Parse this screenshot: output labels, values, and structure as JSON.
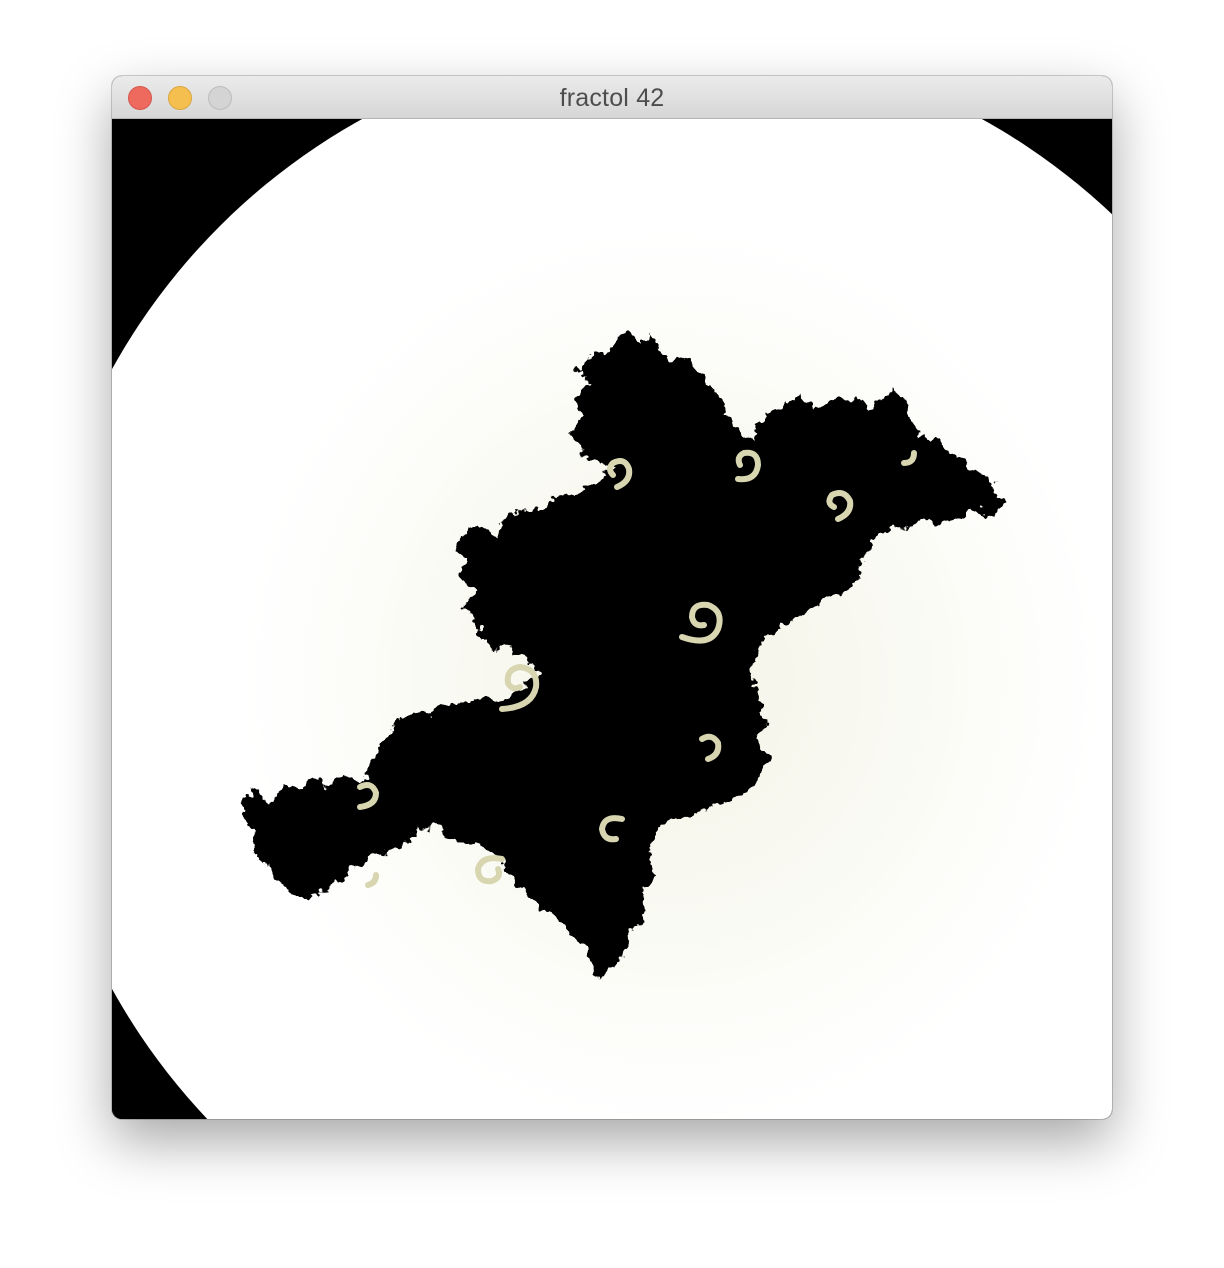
{
  "window": {
    "title": "fractol 42"
  },
  "controls": {
    "close_icon": "close-icon",
    "minimize_icon": "minimize-icon",
    "zoom_icon": "zoom-icon"
  },
  "fractal": {
    "background_color": "#000000",
    "escape_disc_color": "#ffffff",
    "halo_color": "#f8f8f0",
    "set_color": "#000000",
    "spiral_color": "#d8d6b0"
  }
}
